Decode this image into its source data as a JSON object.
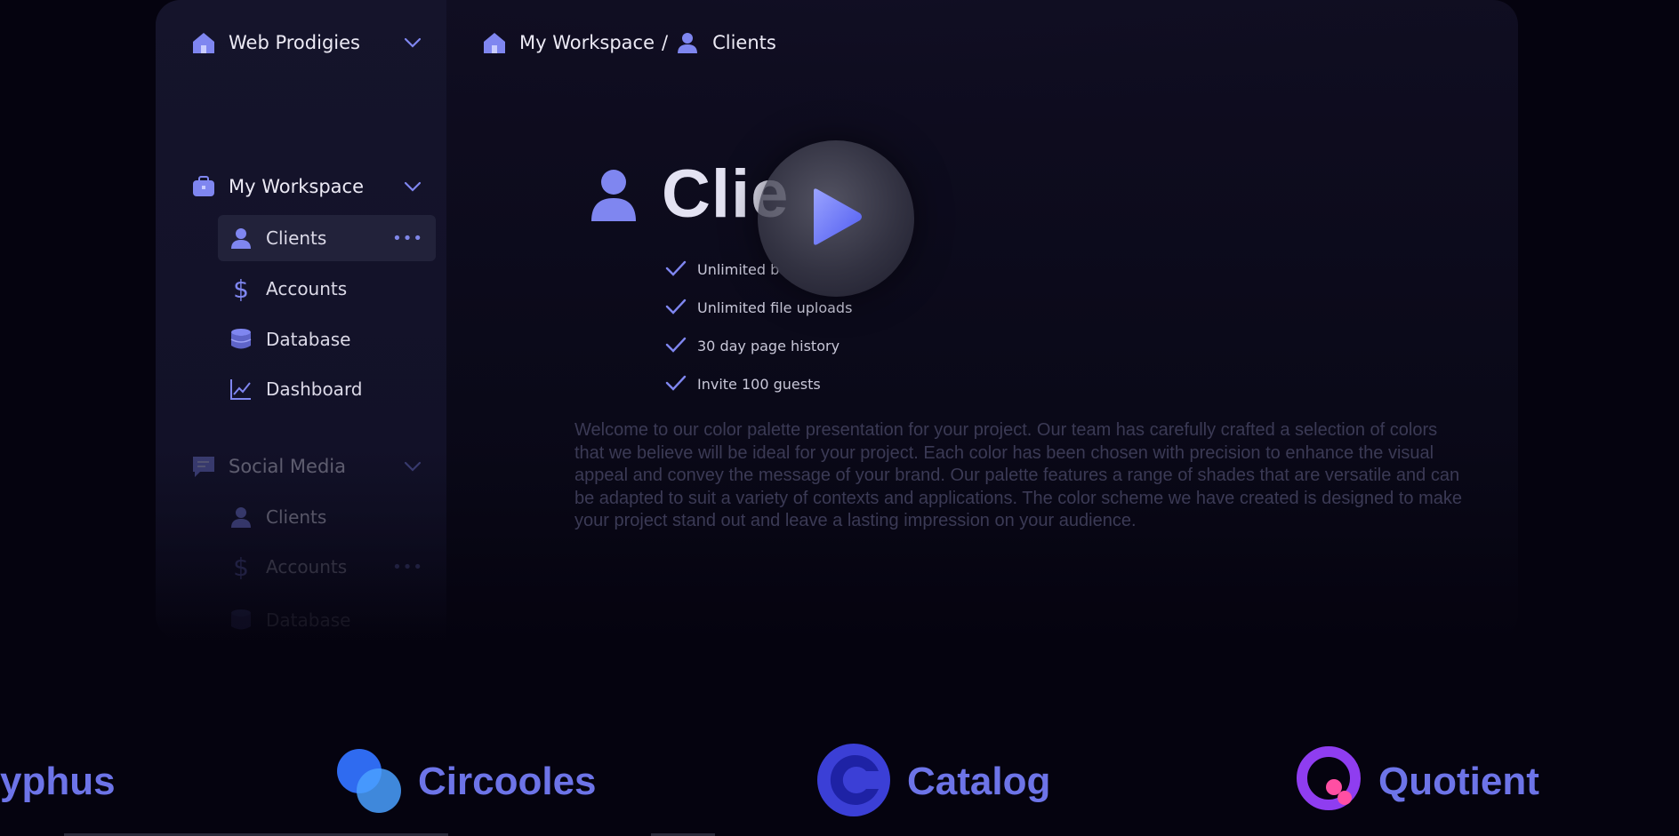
{
  "sidebar": {
    "org": {
      "name": "Web Prodigies",
      "icon": "home-icon"
    },
    "groups": [
      {
        "label": "My Workspace",
        "icon": "briefcase-icon",
        "items": [
          {
            "label": "Clients",
            "icon": "user-icon",
            "active": true
          },
          {
            "label": "Accounts",
            "icon": "dollar-icon"
          },
          {
            "label": "Database",
            "icon": "database-icon"
          },
          {
            "label": "Dashboard",
            "icon": "chart-icon"
          }
        ]
      },
      {
        "label": "Social Media",
        "icon": "chat-icon",
        "items": [
          {
            "label": "Clients",
            "icon": "user-icon"
          },
          {
            "label": "Accounts",
            "icon": "dollar-icon"
          },
          {
            "label": "Database",
            "icon": "database-icon"
          }
        ]
      }
    ]
  },
  "breadcrumb": {
    "workspace": "My Workspace",
    "separator": "/",
    "page": "Clients"
  },
  "main": {
    "title": "Clie",
    "features": [
      "Unlimited b",
      "Unlimited file uploads",
      "30 day page history",
      "Invite 100 guests"
    ],
    "description": "Welcome to our color palette presentation for your project. Our team has carefully crafted a selection of colors that we believe will be ideal for your project. Each color has been chosen with precision to enhance the visual appeal and convey the message of your brand. Our palette features a range of shades that are versatile and can be adapted to suit a variety of contexts and applications. The color scheme we have created is designed to make your project stand out and leave a lasting impression on your audience."
  },
  "logos": [
    {
      "name": "yphus"
    },
    {
      "name": "Circooles"
    },
    {
      "name": "Catalog"
    },
    {
      "name": "Quotient"
    }
  ],
  "colors": {
    "accent": "#7f86f0",
    "background": "#05030f",
    "sidebar": "#15142b",
    "logo_text": "#6d74e8"
  }
}
